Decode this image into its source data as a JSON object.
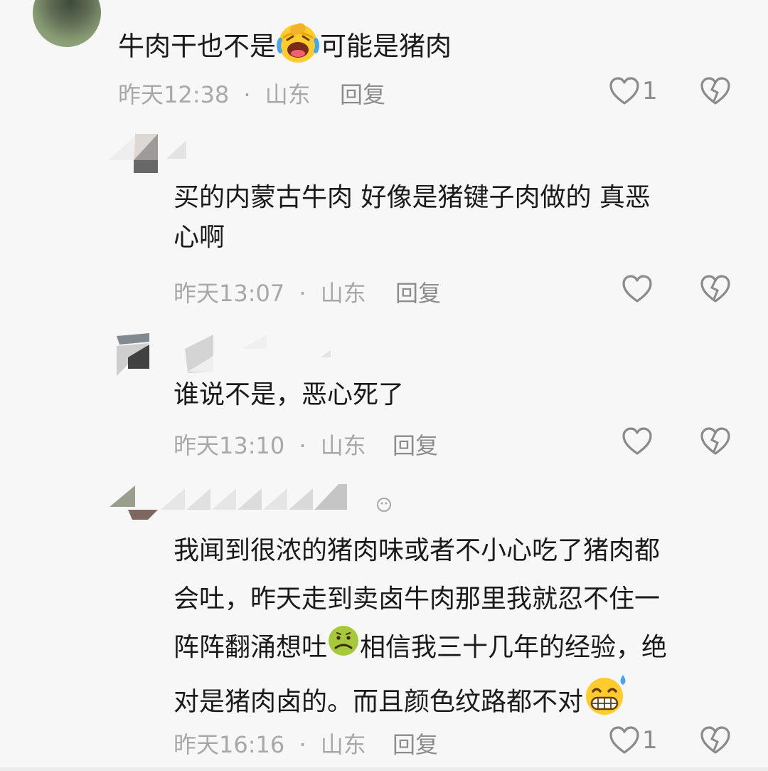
{
  "comments": [
    {
      "text": "牛肉干也不是",
      "text_after_emoji": "可能是猪肉",
      "emoji": "laughing-tears-emoji",
      "time": "昨天12:38",
      "location": "山东",
      "reply_label": "回复",
      "likes": "1"
    },
    {
      "text": "买的内蒙古牛肉  好像是猪键子肉做的 真恶",
      "text_line2": "心啊",
      "time": "昨天13:07",
      "location": "山东",
      "reply_label": "回复",
      "likes": ""
    },
    {
      "text": "谁说不是，恶心死了",
      "time": "昨天13:10",
      "location": "山东",
      "reply_label": "回复",
      "likes": ""
    },
    {
      "lines": [
        "我闻到很浓的猪肉味或者不小心吃了猪肉都",
        "会吐，昨天走到卖卤牛肉那里我就忍不住一",
        "阵阵翻涌想吐",
        "相信我三十几年的经验，绝",
        "对是猪肉卤的。而且颜色纹路都不对"
      ],
      "emojis": [
        "nauseated-emoji",
        "grimacing-sweat-emoji"
      ],
      "time": "昨天16:16",
      "location": "山东",
      "reply_label": "回复",
      "likes": "1"
    }
  ],
  "separator": "·",
  "icons": {
    "like": "heart-outline-icon",
    "dislike": "broken-heart-icon"
  },
  "colors": {
    "background": "#f7f7f7",
    "text": "#1a1a1a",
    "meta": "#a8a8a8",
    "icon": "#8a8a8a"
  }
}
